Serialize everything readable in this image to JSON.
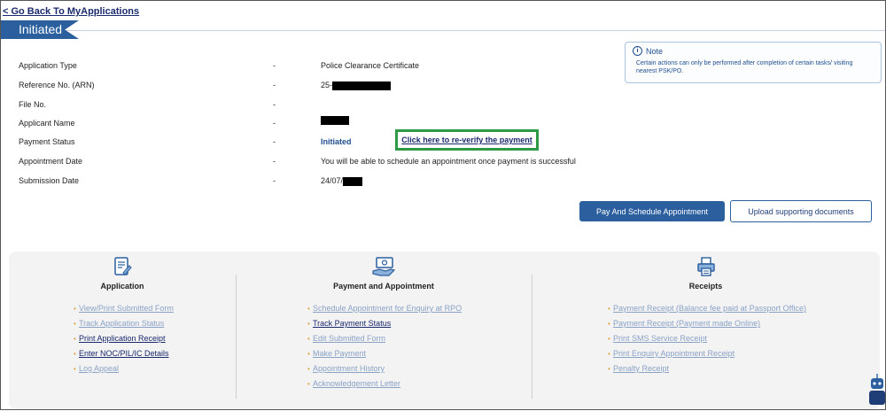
{
  "back_link": "< Go Back To MyApplications",
  "status_ribbon": "Initiated",
  "details": [
    {
      "label": "Application Type",
      "sep": "-",
      "value": "Police Clearance Certificate"
    },
    {
      "label": "Reference No. (ARN)",
      "sep": "-",
      "value": "25-"
    },
    {
      "label": "File No.",
      "sep": "-",
      "value": ""
    },
    {
      "label": "Applicant Name",
      "sep": "-",
      "value": ""
    },
    {
      "label": "Payment Status",
      "sep": "-",
      "value": "Initiated"
    },
    {
      "label": "Appointment Date",
      "sep": "-",
      "value": "You will be able to schedule an appointment once payment is successful"
    },
    {
      "label": "Submission Date",
      "sep": "-",
      "value": "24/07/"
    }
  ],
  "reverify_link": "Click here to re-verify the payment",
  "note": {
    "title": "Note",
    "text": "Certain actions can only be performed after completion of certain tasks/ visiting nearest PSK/PO."
  },
  "buttons": {
    "pay": "Pay And Schedule Appointment",
    "upload": "Upload supporting documents"
  },
  "panel": {
    "application": {
      "title": "Application",
      "icon": "application-form-icon",
      "links": [
        {
          "label": "View/Print Submitted Form",
          "enabled": false
        },
        {
          "label": "Track Application Status",
          "enabled": false
        },
        {
          "label": "Print Application Receipt",
          "enabled": true
        },
        {
          "label": "Enter NOC/PIL/IC Details",
          "enabled": true
        },
        {
          "label": "Log Appeal",
          "enabled": false
        }
      ]
    },
    "payment": {
      "title": "Payment and Appointment",
      "icon": "payment-hand-icon",
      "links": [
        {
          "label": "Schedule Appointment for Enquiry at RPO",
          "enabled": false
        },
        {
          "label": "Track Payment Status",
          "enabled": true
        },
        {
          "label": "Edit Submitted Form",
          "enabled": false
        },
        {
          "label": "Make Payment",
          "enabled": false
        },
        {
          "label": "Appointment History",
          "enabled": false
        },
        {
          "label": "Acknowledgement Letter",
          "enabled": false
        }
      ]
    },
    "receipts": {
      "title": "Receipts",
      "icon": "printer-receipt-icon",
      "links": [
        {
          "label": "Payment Receipt (Balance fee paid at Passport Office)",
          "enabled": false
        },
        {
          "label": "Payment Receipt (Payment made Online)",
          "enabled": false
        },
        {
          "label": "Print SMS Service Receipt",
          "enabled": false
        },
        {
          "label": "Print Enquiry Appointment Receipt",
          "enabled": false
        },
        {
          "label": "Penalty Receipt",
          "enabled": false
        }
      ]
    }
  },
  "colors": {
    "primary": "#2b5f9e",
    "highlight_box": "#2e9a46",
    "link_disabled": "#8aa2c4",
    "link_enabled": "#1a2a6c"
  }
}
